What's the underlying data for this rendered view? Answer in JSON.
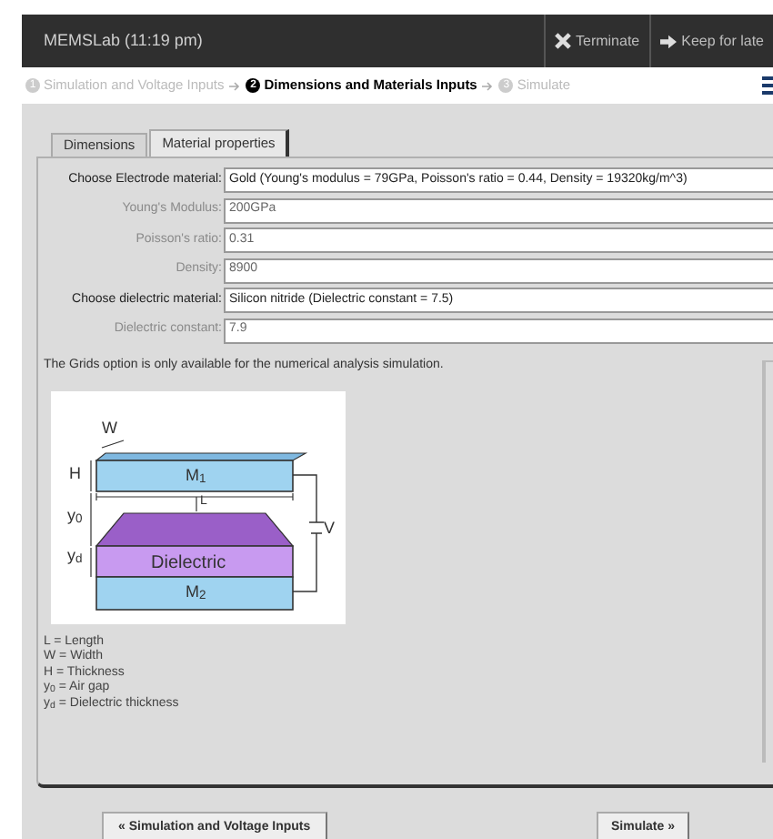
{
  "header": {
    "title": "MEMSLab (11:19 pm)",
    "actions": [
      {
        "kind": "terminate",
        "label": "Terminate"
      },
      {
        "kind": "keep",
        "label": "Keep for late"
      }
    ]
  },
  "steps": [
    {
      "number": "1",
      "label": "Simulation and Voltage Inputs",
      "selected": false
    },
    {
      "number": "2",
      "label": "Dimensions and Materials Inputs",
      "selected": true
    },
    {
      "number": "3",
      "label": "Simulate",
      "selected": false
    }
  ],
  "tabs": [
    {
      "label": "Dimensions",
      "selected": false
    },
    {
      "label": "Material properties",
      "selected": true
    }
  ],
  "fields": [
    {
      "label": "Choose Electrode material:",
      "value": "Gold (Young's modulus = 79GPa, Poisson's ratio = 0.44, Density = 19320kg/m^3)",
      "disabled": false
    },
    {
      "label": "Young's Modulus:",
      "value": "200GPa",
      "disabled": true
    },
    {
      "label": "Poisson's ratio:",
      "value": "0.31",
      "disabled": true
    },
    {
      "label": "Density:",
      "value": "8900",
      "disabled": true
    },
    {
      "label": "Choose dielectric material:",
      "value": "Silicon nitride (Dielectric constant = 7.5)",
      "disabled": false
    },
    {
      "label": "Dielectric constant:",
      "value": "7.9",
      "disabled": true
    }
  ],
  "note": "The Grids option is only available for the numerical analysis simulation.",
  "diagram_labels": {
    "w": "W",
    "h": "H",
    "y0": "y$_{0}$",
    "yd": "y$_{d}$",
    "m1": "M$_{1}$",
    "m2": "M$_{2}$",
    "l": "L",
    "dielectric": "Dielectric",
    "v": "V"
  },
  "legend": [
    "L = Length",
    "W = Width",
    "H = Thickness",
    "y$_{0}$ = Air gap",
    "y$_{d}$ = Dielectric thickness"
  ],
  "buttons": {
    "back": "« Simulation and Voltage Inputs",
    "next": "Simulate »"
  }
}
